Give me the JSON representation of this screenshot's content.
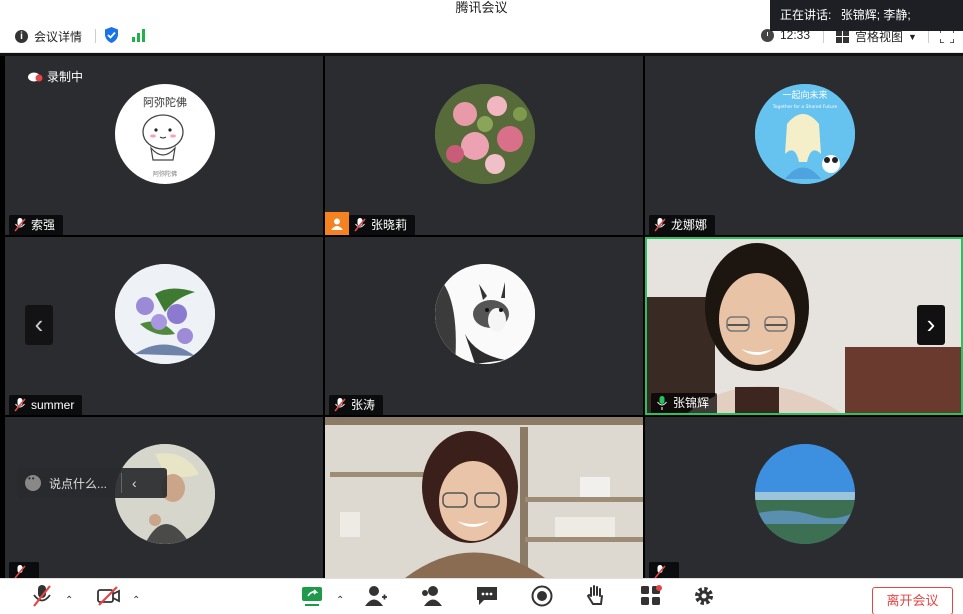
{
  "window": {
    "title": "腾讯会议"
  },
  "speaking": {
    "label": "正在讲话:",
    "names": "张锦辉; 李静;"
  },
  "infobar": {
    "meeting_details": "会议详情",
    "time": "12:33",
    "view_mode": "宫格视图"
  },
  "recording": {
    "label": "录制中"
  },
  "participants": [
    {
      "name": "索强",
      "muted": true
    },
    {
      "name": "张晓莉",
      "muted": true,
      "host_badge": true
    },
    {
      "name": "龙娜娜",
      "muted": true
    },
    {
      "name": "summer",
      "muted": true
    },
    {
      "name": "张涛",
      "muted": true
    },
    {
      "name": "张锦辉",
      "muted": false,
      "speaking": true
    },
    {
      "name": "",
      "muted": true
    },
    {
      "name": "",
      "muted": true
    },
    {
      "name": "",
      "muted": true
    }
  ],
  "avatar_captions": {
    "tile1_top": "阿弥陀佛",
    "tile1_bottom": "阿弥陀佛",
    "tile3_top": "一起向未来",
    "tile3_sub": "Together for a Shared Future"
  },
  "chat": {
    "placeholder": "说点什么..."
  },
  "toolbar": {
    "leave_button": "离开会议"
  },
  "colors": {
    "tile_bg": "#2a2c30",
    "active_border": "#22c55e",
    "leave_red": "#e54545",
    "host_badge": "#f58220",
    "muted_red": "#e54545"
  }
}
